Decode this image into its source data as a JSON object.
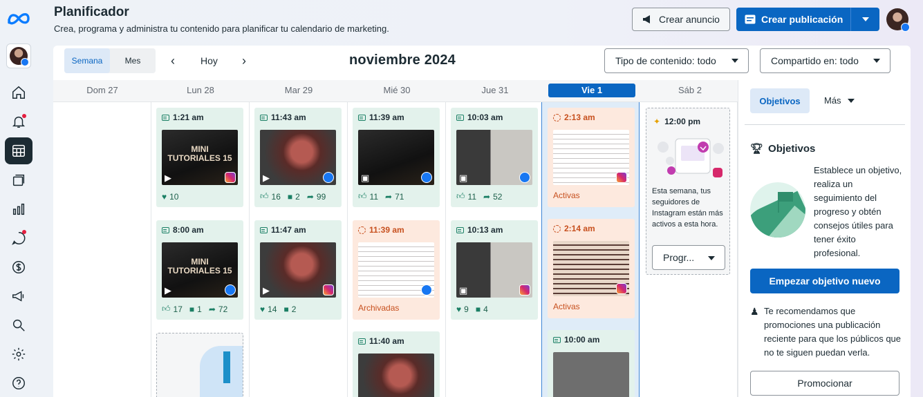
{
  "header": {
    "title": "Planificador",
    "subtitle": "Crea, programa y administra tu contenido para planificar tu calendario de marketing.",
    "create_ad_label": "Crear anuncio",
    "create_post_label": "Crear publicación"
  },
  "toolbar": {
    "view_week": "Semana",
    "view_month": "Mes",
    "today": "Hoy",
    "month_title": "noviembre 2024",
    "content_type_filter": "Tipo de contenido: todo",
    "shared_filter": "Compartido en: todo"
  },
  "days": [
    "Dom 27",
    "Lun 28",
    "Mar 29",
    "Mié 30",
    "Jue 31",
    "Vie 1",
    "Sáb 2"
  ],
  "posts": {
    "mon": [
      {
        "time": "1:21 am",
        "thumb_text": "MINI TUTORIALES 15",
        "likes": "10"
      },
      {
        "time": "8:00 am",
        "thumb_text": "MINI TUTORIALES 15",
        "likes": "17",
        "comments": "1",
        "shares": "72"
      }
    ],
    "tue": [
      {
        "time": "11:43 am",
        "likes": "16",
        "comments": "2",
        "shares": "99"
      },
      {
        "time": "11:47 am",
        "likes": "14",
        "comments": "2"
      }
    ],
    "wed": [
      {
        "time": "11:39 am",
        "likes": "11",
        "shares": "71"
      },
      {
        "time": "11:39 am",
        "status": "Archivadas"
      },
      {
        "time": "11:40 am"
      }
    ],
    "thu": [
      {
        "time": "10:03 am",
        "likes": "11",
        "shares": "52"
      },
      {
        "time": "10:13 am",
        "likes": "9",
        "comments": "4"
      }
    ],
    "fri": [
      {
        "time": "2:13 am",
        "status": "Activas"
      },
      {
        "time": "2:14 am",
        "status": "Activas"
      },
      {
        "time": "10:00 am"
      }
    ],
    "sat": {
      "time": "12:00 pm",
      "text": "Esta semana, tus seguidores de Instagram están más activos a esta hora.",
      "button": "Progr..."
    }
  },
  "side": {
    "tab_objectives": "Objetivos",
    "tab_more": "Más",
    "objectives_title": "Objetivos",
    "objectives_desc": "Establece un objetivo, realiza un seguimiento del progreso y obtén consejos útiles para tener éxito profesional.",
    "start_goal_button": "Empezar objetivo nuevo",
    "recommendation": "Te recomendamos que promociones una publicación reciente para que los públicos que no te siguen puedan verla.",
    "promote_button": "Promocionar"
  },
  "colors": {
    "accent": "#0a66c2",
    "published_card": "#e3f2ec",
    "scheduled_card": "#fde9de",
    "status_text": "#c7501e"
  }
}
